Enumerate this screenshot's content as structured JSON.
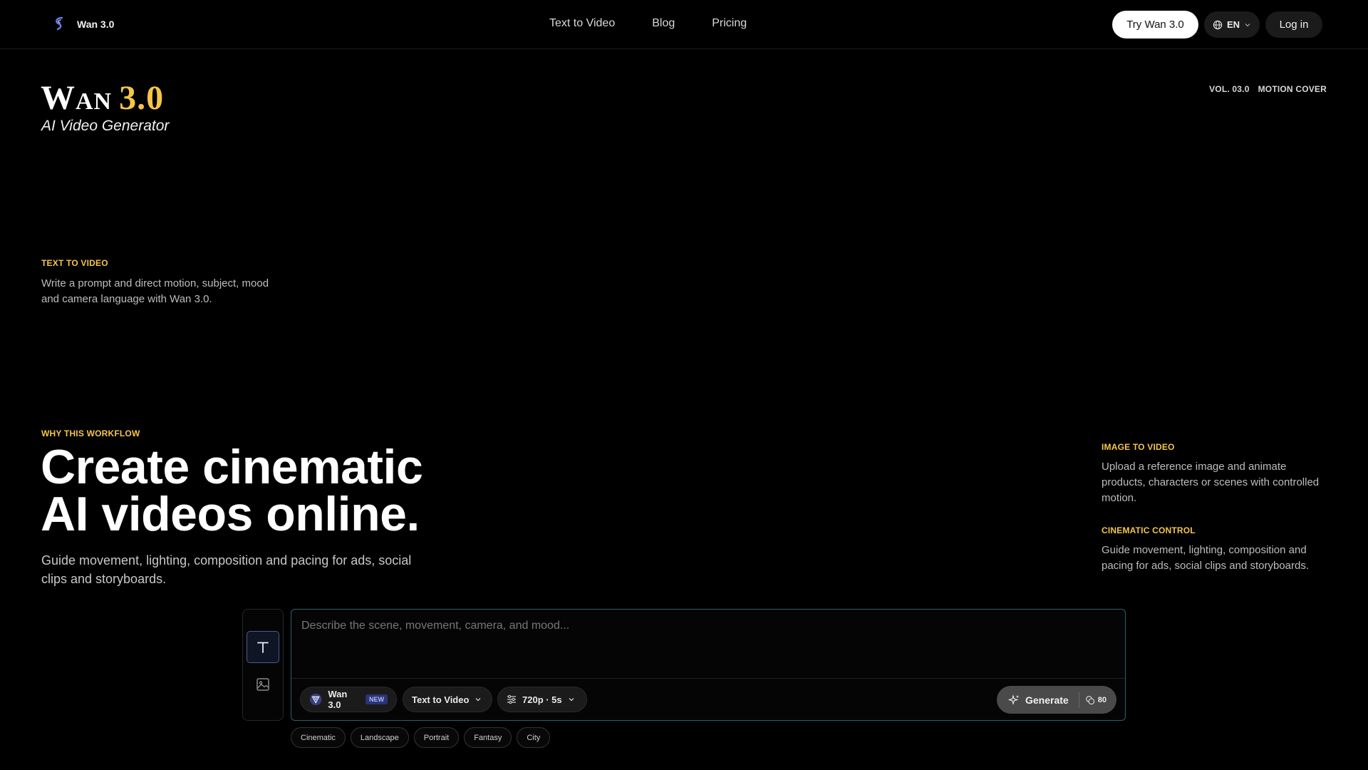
{
  "header": {
    "brand_name": "Wan 3.0",
    "nav": [
      "Text to Video",
      "Blog",
      "Pricing"
    ],
    "try_label": "Try Wan 3.0",
    "lang_label": "EN",
    "login_label": "Log in"
  },
  "hero": {
    "title_word": "Wan",
    "title_version": "3.0",
    "subtitle": "AI Video Generator",
    "vol": "VOL. 03.0",
    "cover": "MOTION COVER"
  },
  "text_to_video": {
    "eyebrow": "TEXT TO VIDEO",
    "body": "Write a prompt and direct motion, subject, mood and camera language with Wan 3.0."
  },
  "why": {
    "eyebrow": "WHY THIS WORKFLOW",
    "headline_1": "Create cinematic",
    "headline_2": "AI videos online.",
    "body": "Guide movement, lighting, composition and pacing for ads, social clips and storyboards."
  },
  "image_to_video": {
    "eyebrow": "IMAGE TO VIDEO",
    "body": "Upload a reference image and animate products, characters or scenes with controlled motion."
  },
  "cinematic_control": {
    "eyebrow": "CINEMATIC CONTROL",
    "body": "Guide movement, lighting, composition and pacing for ads, social clips and storyboards."
  },
  "composer": {
    "placeholder": "Describe the scene, movement, camera, and mood...",
    "model_label": "Wan 3.0",
    "model_badge": "NEW",
    "mode_label": "Text to Video",
    "res_label": "720p · 5s",
    "generate_label": "Generate",
    "cost": "80"
  },
  "chips": [
    "Cinematic",
    "Landscape",
    "Portrait",
    "Fantasy",
    "City"
  ],
  "colors": {
    "accent": "#f5c54a",
    "composer_border": "#2d5f6a",
    "badge_bg": "#2b3474"
  }
}
